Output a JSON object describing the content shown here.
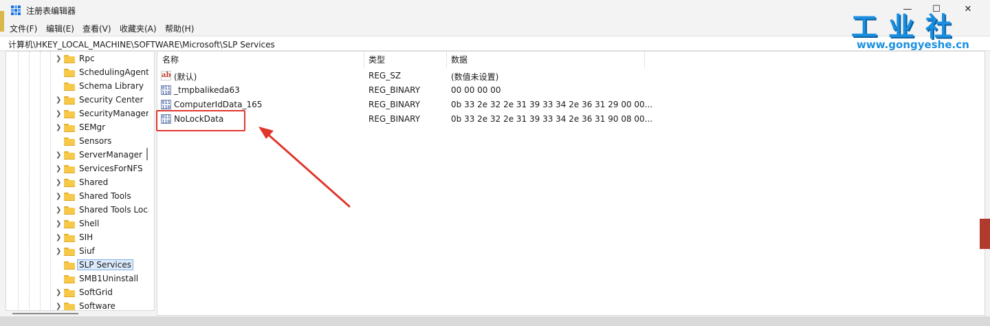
{
  "window": {
    "title": "注册表编辑器",
    "min_glyph": "—",
    "max_glyph": "☐",
    "close_glyph": "✕"
  },
  "menu": [
    "文件(F)",
    "编辑(E)",
    "查看(V)",
    "收藏夹(A)",
    "帮助(H)"
  ],
  "address": "计算机\\HKEY_LOCAL_MACHINE\\SOFTWARE\\Microsoft\\SLP Services",
  "tree": {
    "items": [
      {
        "label": "Rpc",
        "expandable": true
      },
      {
        "label": "SchedulingAgent",
        "expandable": false
      },
      {
        "label": "Schema Library",
        "expandable": false
      },
      {
        "label": "Security Center",
        "expandable": true
      },
      {
        "label": "SecurityManager",
        "expandable": true
      },
      {
        "label": "SEMgr",
        "expandable": true
      },
      {
        "label": "Sensors",
        "expandable": false
      },
      {
        "label": "ServerManager",
        "expandable": true
      },
      {
        "label": "ServicesForNFS",
        "expandable": true
      },
      {
        "label": "Shared",
        "expandable": true
      },
      {
        "label": "Shared Tools",
        "expandable": true
      },
      {
        "label": "Shared Tools Location",
        "expandable": true
      },
      {
        "label": "Shell",
        "expandable": true
      },
      {
        "label": "SIH",
        "expandable": true
      },
      {
        "label": "Siuf",
        "expandable": true
      },
      {
        "label": "SLP Services",
        "expandable": false,
        "selected": true
      },
      {
        "label": "SMB1Uninstall",
        "expandable": false
      },
      {
        "label": "SoftGrid",
        "expandable": true
      },
      {
        "label": "Software",
        "expandable": true
      }
    ]
  },
  "list": {
    "headers": {
      "name": "名称",
      "type": "类型",
      "data": "数据"
    },
    "rows": [
      {
        "icon": "string-value-icon",
        "glyph": "ab",
        "name": "(默认)",
        "type": "REG_SZ",
        "data": "(数值未设置)"
      },
      {
        "icon": "binary-value-icon",
        "glyph": "011\n110",
        "name": "_tmpbalikeda63",
        "type": "REG_BINARY",
        "data": "00 00 00 00"
      },
      {
        "icon": "binary-value-icon",
        "glyph": "011\n110",
        "name": "ComputerIdData_165",
        "type": "REG_BINARY",
        "data": "0b 33 2e 32 2e 31 39 33 34 2e 36 31 29 00 00..."
      },
      {
        "icon": "binary-value-icon",
        "glyph": "011\n110",
        "name": "NoLockData",
        "type": "REG_BINARY",
        "data": "0b 33 2e 32 2e 31 39 33 34 2e 36 31 90 08 00..."
      }
    ]
  },
  "watermark": {
    "chinese": "工业社",
    "url": "www.gongyeshe.cn"
  },
  "colors": {
    "highlight": "#e0362c",
    "selection": "#dcebfc",
    "logo": "#1a8fe0"
  }
}
